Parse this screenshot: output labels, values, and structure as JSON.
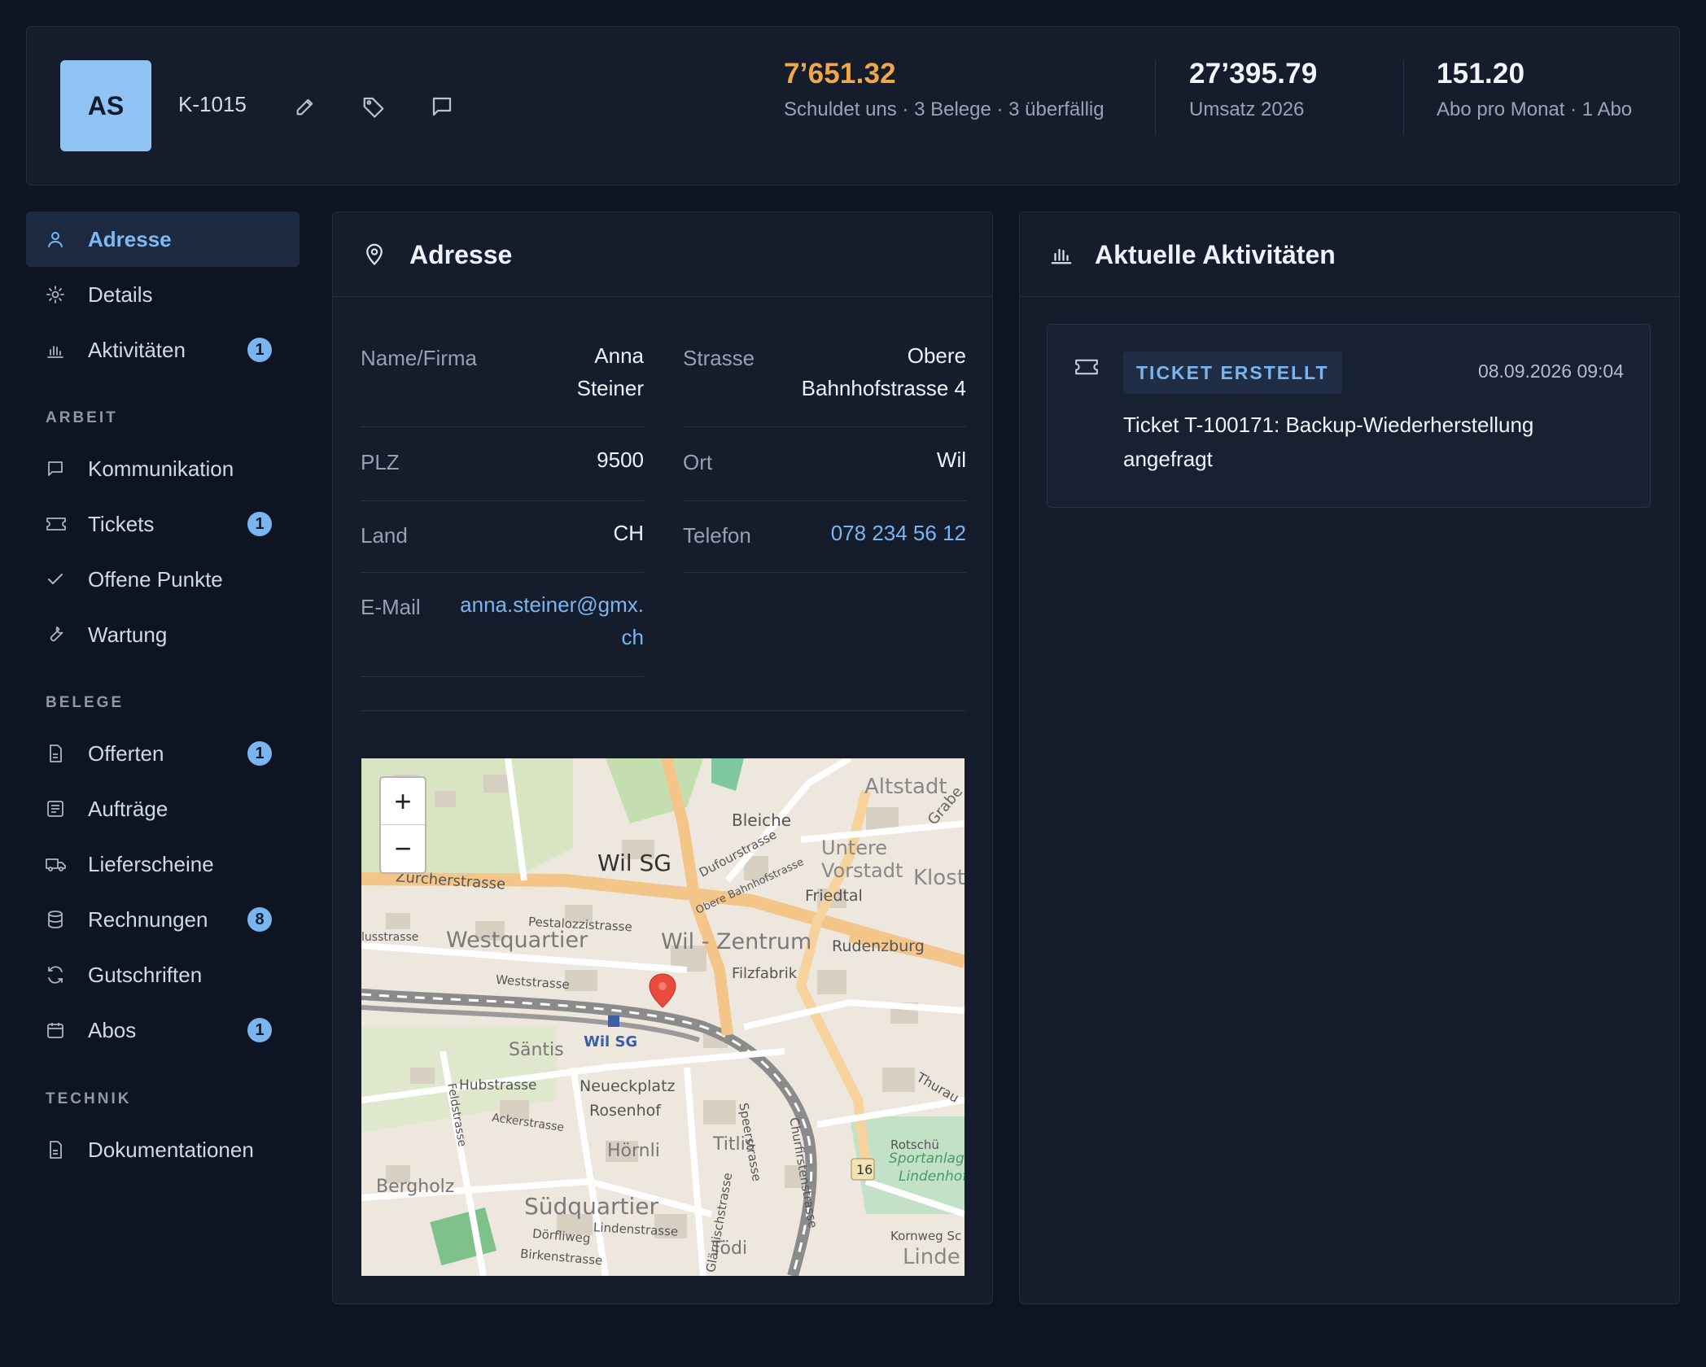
{
  "header": {
    "avatar_initials": "AS",
    "customer_id": "K-1015",
    "icons": [
      "edit-icon",
      "tag-icon",
      "comment-icon"
    ],
    "stats": [
      {
        "value": "7’651.32",
        "label": "Schuldet uns · 3 Belege · 3 überfällig",
        "color": "#f0a74a"
      },
      {
        "value": "27’395.79",
        "label": "Umsatz 2026",
        "color": "#f2f5fa"
      },
      {
        "value": "151.20",
        "label": "Abo pro Monat · 1 Abo",
        "color": "#f2f5fa"
      }
    ]
  },
  "sidebar": {
    "items": [
      {
        "label": "Adresse",
        "icon": "user-icon",
        "active": true
      },
      {
        "label": "Details",
        "icon": "gear-icon"
      },
      {
        "label": "Aktivitäten",
        "icon": "chart-icon",
        "badge": "1"
      }
    ],
    "sections": [
      {
        "title": "ARBEIT",
        "items": [
          {
            "label": "Kommunikation",
            "icon": "chat-icon"
          },
          {
            "label": "Tickets",
            "icon": "ticket-icon",
            "badge": "1"
          },
          {
            "label": "Offene Punkte",
            "icon": "check-icon"
          },
          {
            "label": "Wartung",
            "icon": "wrench-icon"
          }
        ]
      },
      {
        "title": "BELEGE",
        "items": [
          {
            "label": "Offerten",
            "icon": "document-icon",
            "badge": "1"
          },
          {
            "label": "Aufträge",
            "icon": "list-icon"
          },
          {
            "label": "Lieferscheine",
            "icon": "truck-icon"
          },
          {
            "label": "Rechnungen",
            "icon": "database-icon",
            "badge": "8"
          },
          {
            "label": "Gutschriften",
            "icon": "refresh-icon"
          },
          {
            "label": "Abos",
            "icon": "calendar-icon",
            "badge": "1"
          }
        ]
      },
      {
        "title": "TECHNIK",
        "items": [
          {
            "label": "Dokumentationen",
            "icon": "document-icon"
          }
        ]
      }
    ]
  },
  "address": {
    "title": "Adresse",
    "name_label": "Name/Firma",
    "name_value": "Anna\nSteiner",
    "street_label": "Strasse",
    "street_value": "Obere\nBahnhofstrasse 4",
    "zip_label": "PLZ",
    "zip_value": "9500",
    "city_label": "Ort",
    "city_value": "Wil",
    "country_label": "Land",
    "country_value": "CH",
    "phone_label": "Telefon",
    "phone_value": "078 234 56 12",
    "email_label": "E-Mail",
    "email_value": "anna.steiner@gmx.\nch"
  },
  "map": {
    "zoom_in": "+",
    "zoom_out": "−",
    "labels": {
      "altstadt": "Altstadt",
      "bleiche": "Bleiche",
      "wil_sg": "Wil SG",
      "untere_vorstadt": "Untere Vorstadt",
      "zuercherstrasse": "Zürcherstrasse",
      "dufourstrasse": "Dufourstrasse",
      "obere_bahnhofstrasse": "Obere Bahnhofstrasse",
      "friedtal": "Friedtal",
      "klost": "Klost",
      "pestalozzistrasse": "Pestalozzistrasse",
      "westquartier": "Westquartier",
      "wil_zentrum": "Wil - Zentrum",
      "rudenzburg": "Rudenzburg",
      "filzfabrik": "Filzfabrik",
      "weststrasse": "Weststrasse",
      "saentis": "Säntis",
      "wil_sg_station": "Wil SG",
      "hubstrasse": "Hubstrasse",
      "neueckplatz": "Neueckplatz",
      "rosenhof": "Rosenhof",
      "ackerstrasse": "Ackerstrasse",
      "hoernli": "Hörnli",
      "titlis": "Titlis",
      "bergholz": "Bergholz",
      "suedquartier": "Südquartier",
      "doerfliweg": "Dörfliweg",
      "lindenstrasse": "Lindenstrasse",
      "birkenstrasse": "Birkenstrasse",
      "toedi": "Tödi",
      "sportanlage": "Sportanlag",
      "lindenhof": "Lindenhof",
      "road_16": "16",
      "linde": "Linde",
      "kornweg": "Kornweg Sc",
      "speerstrasse": "Speerstrasse",
      "churfirstenstrasse": "Churfirstenstrasse",
      "glaernischstrasse": "Glärnischstrasse",
      "feldstrasse": "Feldstrasse",
      "thurau": "Thurau",
      "grabe": "Grabe",
      "rotschue": "Rotschü",
      "lusstrasse": "lusstrasse"
    }
  },
  "activities": {
    "title": "Aktuelle Aktivitäten",
    "items": [
      {
        "tag": "TICKET ERSTELLT",
        "time": "08.09.2026 09:04",
        "text": "Ticket T-100171: Backup-Wiederherstellung angefragt",
        "icon": "ticket-icon"
      }
    ]
  },
  "colors": {
    "accent": "#7ab5ef",
    "debt": "#f0a74a",
    "background": "#0e1421",
    "panel": "#151d2c"
  }
}
